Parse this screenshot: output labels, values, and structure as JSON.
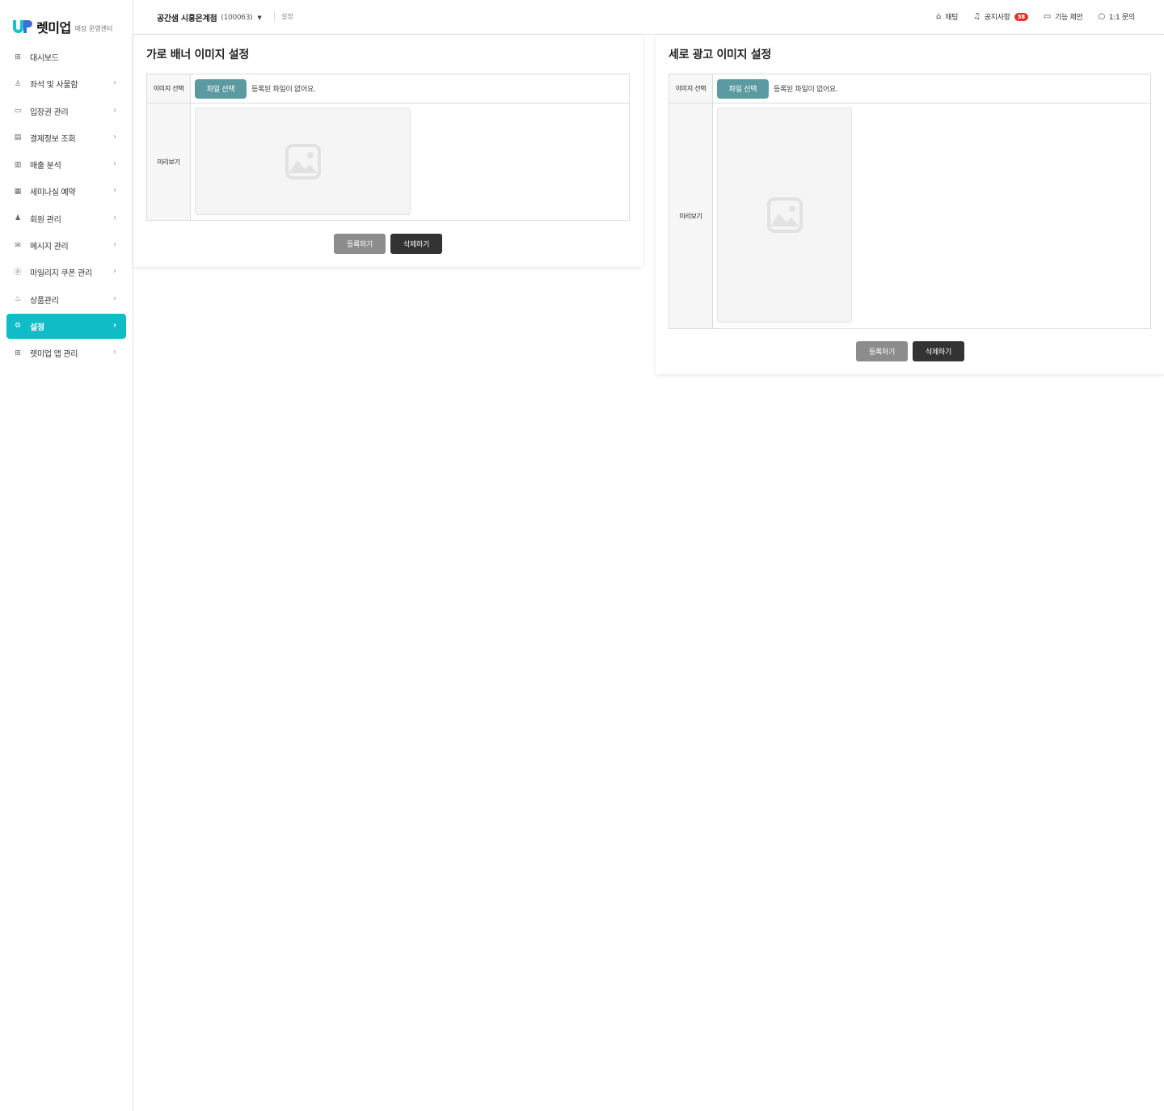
{
  "brand": {
    "name": "렛미업",
    "sub": "매장 운영센터",
    "accent": "#10bcc8"
  },
  "sidebar": {
    "items": [
      {
        "label": "대시보드",
        "icon": "dashboard-icon",
        "glyph": "⊞",
        "chevron": false,
        "active": false
      },
      {
        "label": "좌석 및 사물함",
        "icon": "seat-icon",
        "glyph": "♙",
        "chevron": true,
        "active": false
      },
      {
        "label": "입장권 관리",
        "icon": "ticket-icon",
        "glyph": "▭",
        "chevron": true,
        "active": false
      },
      {
        "label": "결제정보 조회",
        "icon": "card-icon",
        "glyph": "▤",
        "chevron": true,
        "active": false
      },
      {
        "label": "매출 분석",
        "icon": "chart-icon",
        "glyph": "▥",
        "chevron": true,
        "active": false
      },
      {
        "label": "세미나실 예약",
        "icon": "calendar-icon",
        "glyph": "▦",
        "chevron": true,
        "active": false
      },
      {
        "label": "회원 관리",
        "icon": "members-icon",
        "glyph": "♟",
        "chevron": true,
        "active": false
      },
      {
        "label": "메시지 관리",
        "icon": "mail-icon",
        "glyph": "✉",
        "chevron": true,
        "active": false
      },
      {
        "label": "마일리지 쿠폰 관리",
        "icon": "mileage-icon",
        "glyph": "ⓟ",
        "chevron": true,
        "active": false
      },
      {
        "label": "상품관리",
        "icon": "product-icon",
        "glyph": "♨",
        "chevron": true,
        "active": false
      },
      {
        "label": "설정",
        "icon": "settings-icon",
        "glyph": "⚙",
        "chevron": true,
        "active": true
      },
      {
        "label": "렛미업 앱 관리",
        "icon": "app-icon",
        "glyph": "⊞",
        "chevron": true,
        "active": false
      }
    ]
  },
  "header": {
    "store_name": "공간샘 시흥은계점",
    "store_code": "(100063)",
    "breadcrumb": "설정",
    "links": {
      "chat": "채팅",
      "notice": "공지사항",
      "notice_count": "38",
      "suggest": "기능 제안",
      "inquiry": "1:1 문의"
    }
  },
  "panels": {
    "horizontal": {
      "title": "가로 배너 이미지 설정",
      "select_label": "이미지 선택",
      "file_button": "파일 선택",
      "file_status": "등록된 파일이 없어요.",
      "preview_label": "미리보기",
      "register_button": "등록하기",
      "delete_button": "삭제하기"
    },
    "vertical": {
      "title": "세로 광고 이미지 설정",
      "select_label": "이미지 선택",
      "file_button": "파일 선택",
      "file_status": "등록된 파일이 없어요.",
      "preview_label": "미리보기",
      "register_button": "등록하기",
      "delete_button": "삭제하기"
    }
  }
}
